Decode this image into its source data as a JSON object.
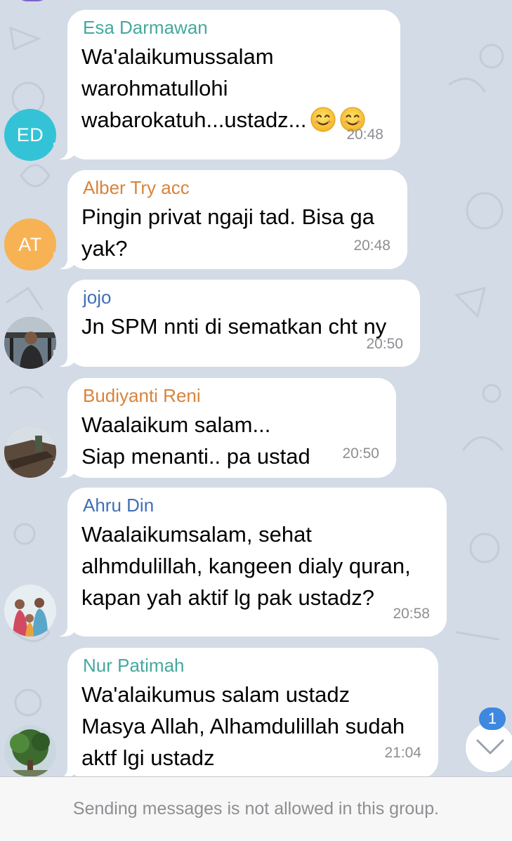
{
  "colors": {
    "background": "#d3dbe6",
    "bubble": "#ffffff",
    "time": "#8e8e93",
    "badge": "#3e88e0"
  },
  "messages": [
    {
      "sender": "Esa Darmawan",
      "sender_color": "#45a89e",
      "avatar_initials": "ED",
      "avatar_color": "#34c3d6",
      "lines": [
        "Wa'alaikumussalam",
        "warohmatullohi",
        "wabarokatuh...ustadz..."
      ],
      "emojis": [
        "smiling-face-emoji",
        "smiling-face-emoji"
      ],
      "time": "20:48"
    },
    {
      "sender": "Alber Try acc",
      "sender_color": "#d9833a",
      "avatar_initials": "AT",
      "avatar_color": "#f7b254",
      "lines": [
        "Pingin privat ngaji tad. Bisa ga",
        "yak?"
      ],
      "time": "20:48"
    },
    {
      "sender": "jojo",
      "sender_color": "#3f6fb8",
      "avatar_photo": "person-photo",
      "lines": [
        "Jn SPM nnti di sematkan cht ny"
      ],
      "time": "20:50"
    },
    {
      "sender": "Budiyanti Reni",
      "sender_color": "#d9833a",
      "avatar_photo": "outdoor-photo",
      "lines": [
        "Waalaikum salam...",
        "Siap menanti.. pa ustad"
      ],
      "time": "20:50"
    },
    {
      "sender": "Ahru Din",
      "sender_color": "#3f6fb8",
      "avatar_photo": "group-photo",
      "lines": [
        "Waalaikumsalam, sehat",
        "alhmdulillah, kangeen dialy quran,",
        "kapan yah aktif lg pak ustadz?"
      ],
      "time": "20:58"
    },
    {
      "sender": "Nur Patimah",
      "sender_color": "#45a89e",
      "avatar_photo": "tree-photo",
      "lines": [
        "Wa'alaikumus salam ustadz",
        "Masya Allah, Alhamdulillah sudah",
        "aktf lgi ustadz"
      ],
      "time": "21:04"
    }
  ],
  "scroll_to_bottom": {
    "unread_count": "1",
    "icon": "chevron-down-icon"
  },
  "footer": {
    "notice": "Sending messages is not allowed in this group."
  }
}
